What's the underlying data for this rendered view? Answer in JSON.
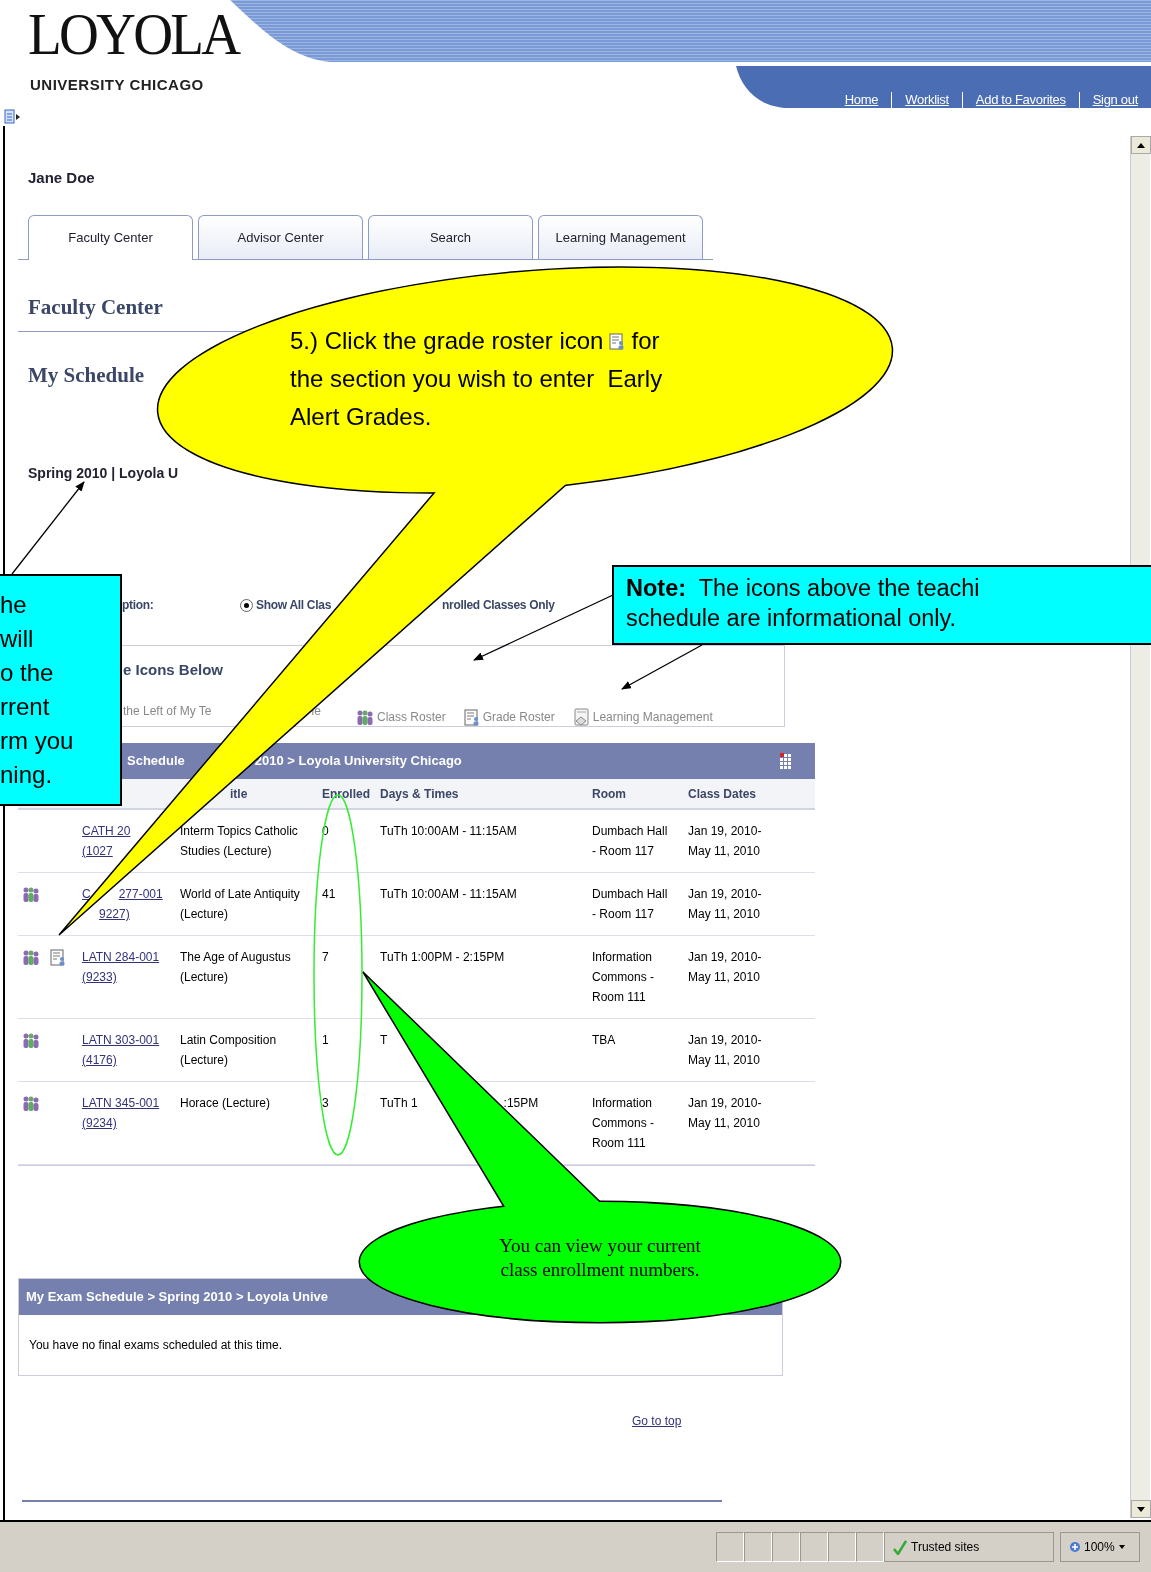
{
  "header": {
    "logo": "LOYOLA",
    "logo_subtitle": "UNIVERSITY CHICAGO",
    "links": [
      "Home",
      "Worklist",
      "Add to Favorites",
      "Sign out"
    ]
  },
  "user_name": "Jane Doe",
  "tabs": [
    {
      "label": "Faculty Center",
      "selected": true
    },
    {
      "label": "Advisor Center",
      "selected": false
    },
    {
      "label": "Search",
      "selected": false
    },
    {
      "label": "Learning Management",
      "selected": false
    }
  ],
  "page_title": "Faculty Center",
  "section_title": "My Schedule",
  "term_line": "Spring 2010 | Loyola U",
  "display_option": {
    "label": "ption:",
    "radio": {
      "label": "Show All Clas",
      "selected": true
    },
    "other_option": "nrolled Classes Only"
  },
  "legend": {
    "title": "e Icons Below",
    "note_parts": [
      "the Left of My Te",
      "le"
    ],
    "items": [
      {
        "kind": "class_roster",
        "label": "Class Roster"
      },
      {
        "kind": "grade_roster",
        "label": "Grade Roster"
      },
      {
        "kind": "learning",
        "label": "Learning Management"
      }
    ]
  },
  "schedule": {
    "title_parts": [
      "Schedule",
      "2010 > Loyola University Chicago"
    ],
    "columns": [
      "itle",
      "Enrolled",
      "Days & Times",
      "Room",
      "Class Dates"
    ],
    "rows": [
      {
        "class_roster": false,
        "grade_roster": false,
        "code_parts": [
          "CATH 20"
        ],
        "number": "(1027",
        "title": "Interm Topics Catholic\nStudies (Lecture)",
        "enrolled": "0",
        "days_parts": [
          "TuTh 10:00AM - 11:15AM"
        ],
        "room": "Dumbach Hall\n- Room 117",
        "dates": "Jan 19, 2010-\nMay 11, 2010"
      },
      {
        "class_roster": true,
        "grade_roster": false,
        "code_parts": [
          "C",
          "277-001"
        ],
        "number": "9227)",
        "title": "World of Late Antiquity\n(Lecture)",
        "enrolled": "41",
        "days_parts": [
          "TuTh 10:00AM - 11:15AM"
        ],
        "room": "Dumbach Hall\n- Room 117",
        "dates": "Jan 19, 2010-\nMay 11, 2010"
      },
      {
        "class_roster": true,
        "grade_roster": true,
        "code_parts": [
          "LATN 284-001"
        ],
        "number": "(9233)",
        "title": "The Age of Augustus\n(Lecture)",
        "enrolled": "7",
        "days_parts": [
          "TuTh 1:00PM - 2:15PM"
        ],
        "room": "Information\nCommons -\nRoom 111",
        "dates": "Jan 19, 2010-\nMay 11, 2010"
      },
      {
        "class_roster": true,
        "grade_roster": false,
        "code_parts": [
          "LATN 303-001"
        ],
        "number": "(4176)",
        "title": "Latin Composition\n(Lecture)",
        "enrolled": "1",
        "days_parts": [
          "T"
        ],
        "room": "TBA",
        "dates": "Jan 19, 2010-\nMay 11, 2010"
      },
      {
        "class_roster": true,
        "grade_roster": false,
        "code_parts": [
          "LATN 345-001"
        ],
        "number": "(9234)",
        "title": "Horace (Lecture)",
        "enrolled": "3",
        "days_parts": [
          "TuTh 1",
          ":15PM"
        ],
        "room": "Information\nCommons -\nRoom 111",
        "dates": "Jan 19, 2010-\nMay 11, 2010"
      }
    ]
  },
  "exam": {
    "title": "My Exam Schedule > Spring 2010 > Loyola Unive",
    "message": "You have no final exams scheduled at this time."
  },
  "go_to_top": "Go to top",
  "status_bar": {
    "zone": "Trusted sites",
    "zoom": "100%"
  },
  "callouts": [
    {
      "kind": "speech_yellow",
      "text_before": "5.) Click the grade roster icon",
      "text_after": "for",
      "text_rest": "the section you wish to enter  Early\nAlert Grades."
    },
    {
      "kind": "note_left",
      "text": "he\nwill\no the\nrrent\nrm you\nning."
    },
    {
      "kind": "note_right",
      "text": "**Note:**  The icons above the teachi\nschedule are informational only."
    },
    {
      "kind": "speech_green",
      "text": "You can view your current\nclass enrollment numbers."
    }
  ]
}
